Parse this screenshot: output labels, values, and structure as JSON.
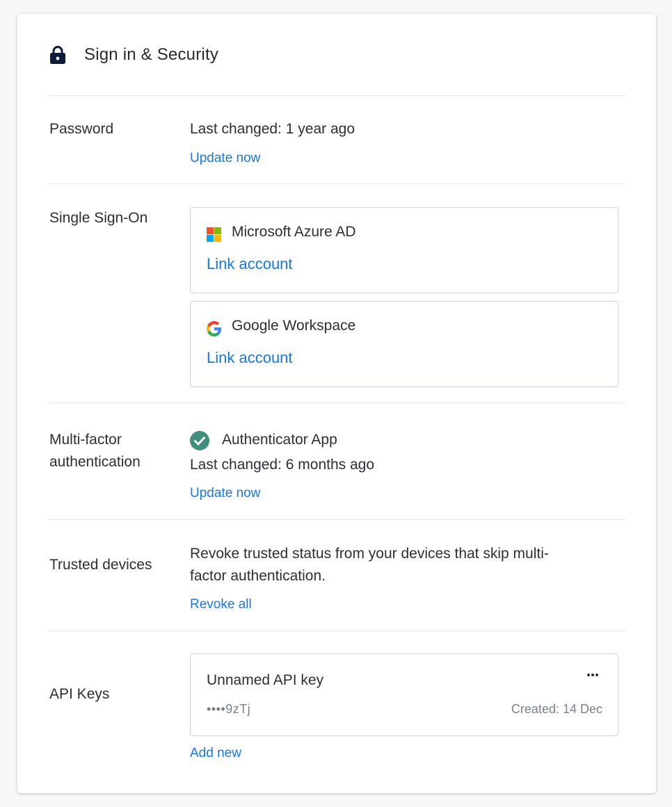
{
  "header": {
    "icon": "lock-icon",
    "title": "Sign in & Security"
  },
  "password": {
    "label": "Password",
    "value": "Last changed: 1 year ago",
    "action": "Update now"
  },
  "sso": {
    "label": "Single Sign-On",
    "providers": [
      {
        "name": "Microsoft Azure AD",
        "icon": "microsoft-logo-icon",
        "action": "Link account"
      },
      {
        "name": "Google Workspace",
        "icon": "google-logo-icon",
        "action": "Link account"
      }
    ]
  },
  "mfa": {
    "label_line1": "Multi-factor",
    "label_line2": "authentication",
    "method": "Authenticator App",
    "status_icon": "check-circle-icon",
    "status_color": "#3f8f7c",
    "value": "Last changed: 6 months ago",
    "action": "Update now"
  },
  "trusted_devices": {
    "label": "Trusted devices",
    "description_line1": "Revoke trusted status from your devices that skip multi-",
    "description_line2": "factor authentication.",
    "action": "Revoke all"
  },
  "api_keys": {
    "label": "API Keys",
    "keys": [
      {
        "name": "Unnamed API key",
        "masked": "••••9zTj",
        "created": "Created: 14 Dec",
        "menu_icon": "more-horizontal-icon"
      }
    ],
    "action": "Add new"
  },
  "colors": {
    "link": "#1976e3",
    "text": "#2b2f36",
    "muted": "#7b818a",
    "border": "#cfd3d9",
    "icon_dark": "#0e1a3b"
  }
}
